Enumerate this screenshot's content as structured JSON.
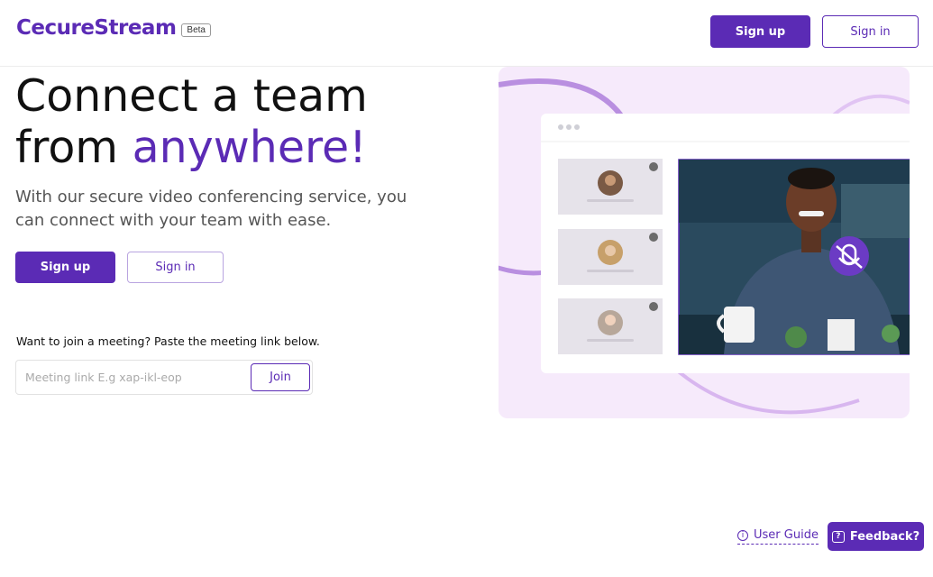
{
  "header": {
    "logo": "CecureStream",
    "beta_badge": "Beta",
    "signup_label": "Sign up",
    "signin_label": "Sign in"
  },
  "hero": {
    "title_line1": "Connect a team",
    "title_line2_prefix": "from ",
    "title_line2_accent": "anywhere!",
    "subtitle": "With our secure video conferencing service, you can connect with your team with ease.",
    "signup_label": "Sign up",
    "signin_label": "Sign in"
  },
  "join": {
    "label": "Want to join a meeting? Paste the meeting link below.",
    "placeholder": "Meeting link E.g xap-ikl-eop",
    "button_label": "Join"
  },
  "footer": {
    "user_guide_label": "User Guide",
    "feedback_label": "Feedback?"
  },
  "icons": {
    "info": "info-circle-icon",
    "feedback": "chat-question-icon",
    "mute": "microphone-off-icon"
  },
  "colors": {
    "brand": "#5b2bb5",
    "illustration_bg": "#f6eafb"
  }
}
